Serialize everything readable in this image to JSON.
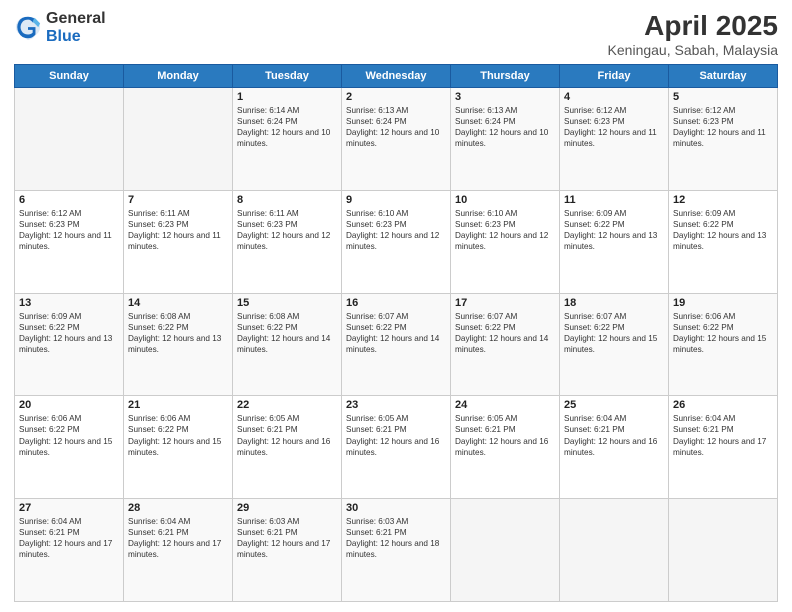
{
  "header": {
    "logo_general": "General",
    "logo_blue": "Blue",
    "title": "April 2025",
    "subtitle": "Keningau, Sabah, Malaysia"
  },
  "days_of_week": [
    "Sunday",
    "Monday",
    "Tuesday",
    "Wednesday",
    "Thursday",
    "Friday",
    "Saturday"
  ],
  "weeks": [
    [
      {
        "day": "",
        "info": ""
      },
      {
        "day": "",
        "info": ""
      },
      {
        "day": "1",
        "info": "Sunrise: 6:14 AM\nSunset: 6:24 PM\nDaylight: 12 hours and 10 minutes."
      },
      {
        "day": "2",
        "info": "Sunrise: 6:13 AM\nSunset: 6:24 PM\nDaylight: 12 hours and 10 minutes."
      },
      {
        "day": "3",
        "info": "Sunrise: 6:13 AM\nSunset: 6:24 PM\nDaylight: 12 hours and 10 minutes."
      },
      {
        "day": "4",
        "info": "Sunrise: 6:12 AM\nSunset: 6:23 PM\nDaylight: 12 hours and 11 minutes."
      },
      {
        "day": "5",
        "info": "Sunrise: 6:12 AM\nSunset: 6:23 PM\nDaylight: 12 hours and 11 minutes."
      }
    ],
    [
      {
        "day": "6",
        "info": "Sunrise: 6:12 AM\nSunset: 6:23 PM\nDaylight: 12 hours and 11 minutes."
      },
      {
        "day": "7",
        "info": "Sunrise: 6:11 AM\nSunset: 6:23 PM\nDaylight: 12 hours and 11 minutes."
      },
      {
        "day": "8",
        "info": "Sunrise: 6:11 AM\nSunset: 6:23 PM\nDaylight: 12 hours and 12 minutes."
      },
      {
        "day": "9",
        "info": "Sunrise: 6:10 AM\nSunset: 6:23 PM\nDaylight: 12 hours and 12 minutes."
      },
      {
        "day": "10",
        "info": "Sunrise: 6:10 AM\nSunset: 6:23 PM\nDaylight: 12 hours and 12 minutes."
      },
      {
        "day": "11",
        "info": "Sunrise: 6:09 AM\nSunset: 6:22 PM\nDaylight: 12 hours and 13 minutes."
      },
      {
        "day": "12",
        "info": "Sunrise: 6:09 AM\nSunset: 6:22 PM\nDaylight: 12 hours and 13 minutes."
      }
    ],
    [
      {
        "day": "13",
        "info": "Sunrise: 6:09 AM\nSunset: 6:22 PM\nDaylight: 12 hours and 13 minutes."
      },
      {
        "day": "14",
        "info": "Sunrise: 6:08 AM\nSunset: 6:22 PM\nDaylight: 12 hours and 13 minutes."
      },
      {
        "day": "15",
        "info": "Sunrise: 6:08 AM\nSunset: 6:22 PM\nDaylight: 12 hours and 14 minutes."
      },
      {
        "day": "16",
        "info": "Sunrise: 6:07 AM\nSunset: 6:22 PM\nDaylight: 12 hours and 14 minutes."
      },
      {
        "day": "17",
        "info": "Sunrise: 6:07 AM\nSunset: 6:22 PM\nDaylight: 12 hours and 14 minutes."
      },
      {
        "day": "18",
        "info": "Sunrise: 6:07 AM\nSunset: 6:22 PM\nDaylight: 12 hours and 15 minutes."
      },
      {
        "day": "19",
        "info": "Sunrise: 6:06 AM\nSunset: 6:22 PM\nDaylight: 12 hours and 15 minutes."
      }
    ],
    [
      {
        "day": "20",
        "info": "Sunrise: 6:06 AM\nSunset: 6:22 PM\nDaylight: 12 hours and 15 minutes."
      },
      {
        "day": "21",
        "info": "Sunrise: 6:06 AM\nSunset: 6:22 PM\nDaylight: 12 hours and 15 minutes."
      },
      {
        "day": "22",
        "info": "Sunrise: 6:05 AM\nSunset: 6:21 PM\nDaylight: 12 hours and 16 minutes."
      },
      {
        "day": "23",
        "info": "Sunrise: 6:05 AM\nSunset: 6:21 PM\nDaylight: 12 hours and 16 minutes."
      },
      {
        "day": "24",
        "info": "Sunrise: 6:05 AM\nSunset: 6:21 PM\nDaylight: 12 hours and 16 minutes."
      },
      {
        "day": "25",
        "info": "Sunrise: 6:04 AM\nSunset: 6:21 PM\nDaylight: 12 hours and 16 minutes."
      },
      {
        "day": "26",
        "info": "Sunrise: 6:04 AM\nSunset: 6:21 PM\nDaylight: 12 hours and 17 minutes."
      }
    ],
    [
      {
        "day": "27",
        "info": "Sunrise: 6:04 AM\nSunset: 6:21 PM\nDaylight: 12 hours and 17 minutes."
      },
      {
        "day": "28",
        "info": "Sunrise: 6:04 AM\nSunset: 6:21 PM\nDaylight: 12 hours and 17 minutes."
      },
      {
        "day": "29",
        "info": "Sunrise: 6:03 AM\nSunset: 6:21 PM\nDaylight: 12 hours and 17 minutes."
      },
      {
        "day": "30",
        "info": "Sunrise: 6:03 AM\nSunset: 6:21 PM\nDaylight: 12 hours and 18 minutes."
      },
      {
        "day": "",
        "info": ""
      },
      {
        "day": "",
        "info": ""
      },
      {
        "day": "",
        "info": ""
      }
    ]
  ]
}
